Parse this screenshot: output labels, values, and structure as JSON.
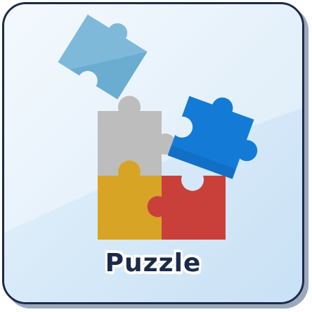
{
  "tile": {
    "label": "Puzzle",
    "icon": "puzzle-pieces-icon"
  },
  "colors": {
    "tile_background": "#d8ebfa",
    "tile_border": "#1c2a4a",
    "piece_light_blue": "#7fb9da",
    "piece_gray": "#bdbdbd",
    "piece_blue": "#137bd6",
    "piece_yellow": "#d7a426",
    "piece_red": "#c9403b",
    "label_text": "#1c2a4a"
  }
}
